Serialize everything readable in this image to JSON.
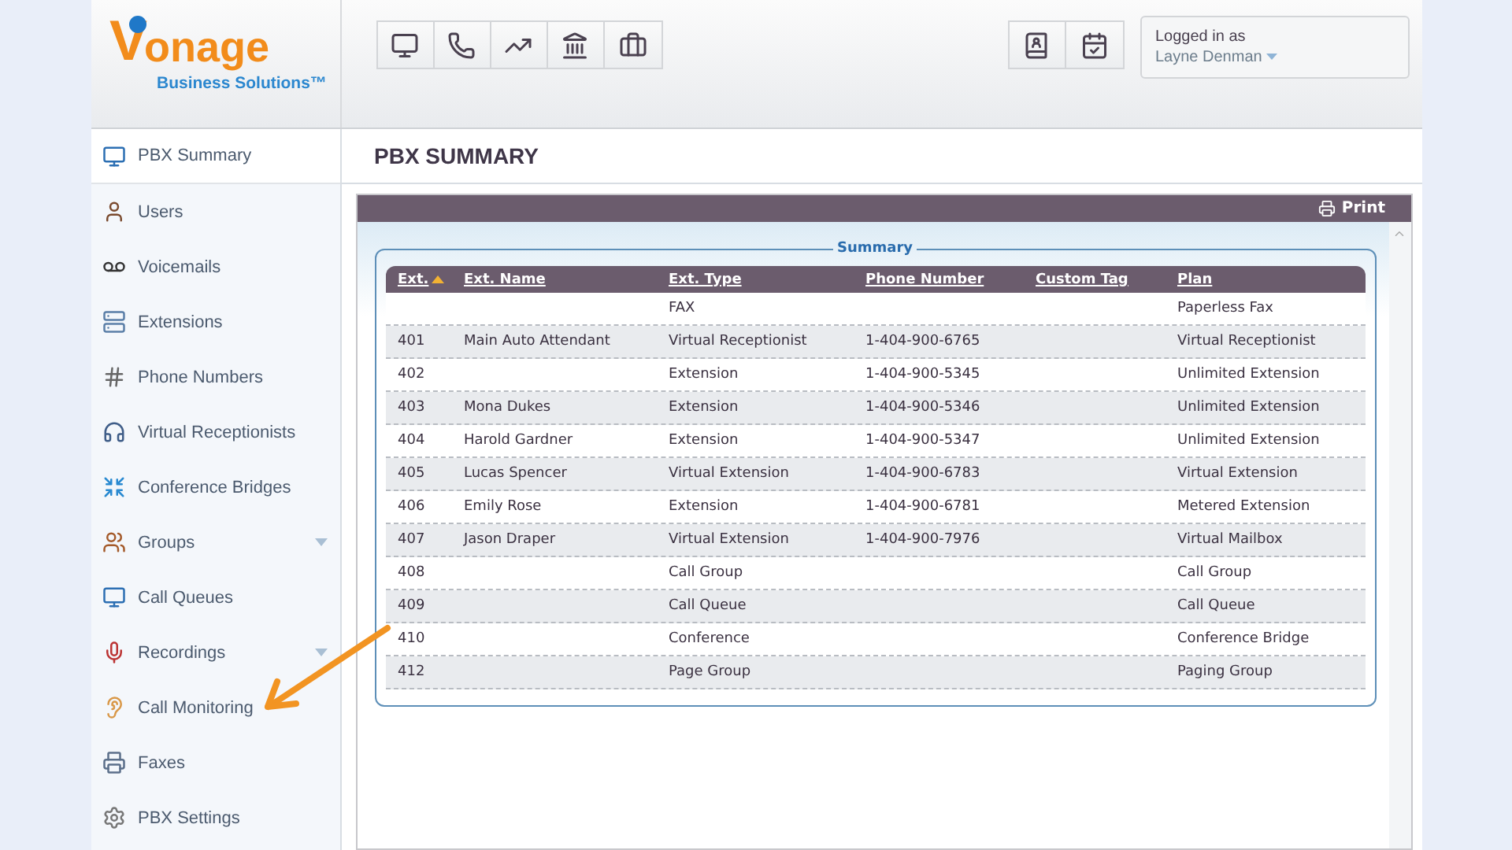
{
  "logo": {
    "initial": "V",
    "rest": "onage",
    "tagline": "Business Solutions™"
  },
  "user": {
    "caption": "Logged in as",
    "name": "Layne Denman"
  },
  "sidebar": {
    "items": [
      {
        "label": "PBX Summary",
        "selected": true,
        "expandable": false
      },
      {
        "label": "Users",
        "selected": false,
        "expandable": false
      },
      {
        "label": "Voicemails",
        "selected": false,
        "expandable": false
      },
      {
        "label": "Extensions",
        "selected": false,
        "expandable": false
      },
      {
        "label": "Phone Numbers",
        "selected": false,
        "expandable": false
      },
      {
        "label": "Virtual Receptionists",
        "selected": false,
        "expandable": false
      },
      {
        "label": "Conference Bridges",
        "selected": false,
        "expandable": false
      },
      {
        "label": "Groups",
        "selected": false,
        "expandable": true
      },
      {
        "label": "Call Queues",
        "selected": false,
        "expandable": false
      },
      {
        "label": "Recordings",
        "selected": false,
        "expandable": true
      },
      {
        "label": "Call Monitoring",
        "selected": false,
        "expandable": false
      },
      {
        "label": "Faxes",
        "selected": false,
        "expandable": false
      },
      {
        "label": "PBX Settings",
        "selected": false,
        "expandable": false
      }
    ]
  },
  "page_title": "PBX SUMMARY",
  "print_label": "Print",
  "summary": {
    "legend": "Summary",
    "columns": [
      {
        "label": "Ext.",
        "sorted": true
      },
      {
        "label": "Ext. Name",
        "sorted": false
      },
      {
        "label": "Ext. Type",
        "sorted": false
      },
      {
        "label": "Phone Number",
        "sorted": false
      },
      {
        "label": "Custom Tag",
        "sorted": false
      },
      {
        "label": "Plan",
        "sorted": false
      }
    ],
    "rows": [
      [
        "",
        "",
        "FAX",
        "",
        "",
        "Paperless Fax"
      ],
      [
        "401",
        "Main Auto Attendant",
        "Virtual Receptionist",
        "1-404-900-6765",
        "",
        "Virtual Receptionist"
      ],
      [
        "402",
        "",
        "Extension",
        "1-404-900-5345",
        "",
        "Unlimited Extension"
      ],
      [
        "403",
        "Mona Dukes",
        "Extension",
        "1-404-900-5346",
        "",
        "Unlimited Extension"
      ],
      [
        "404",
        "Harold Gardner",
        "Extension",
        "1-404-900-5347",
        "",
        "Unlimited Extension"
      ],
      [
        "405",
        "Lucas Spencer",
        "Virtual Extension",
        "1-404-900-6783",
        "",
        "Virtual Extension"
      ],
      [
        "406",
        "Emily Rose",
        "Extension",
        "1-404-900-6781",
        "",
        "Metered Extension"
      ],
      [
        "407",
        "Jason Draper",
        "Virtual Extension",
        "1-404-900-7976",
        "",
        "Virtual Mailbox"
      ],
      [
        "408",
        "",
        "Call Group",
        "",
        "",
        "Call Group"
      ],
      [
        "409",
        "",
        "Call Queue",
        "",
        "",
        "Call Queue"
      ],
      [
        "410",
        "",
        "Conference",
        "",
        "",
        "Conference Bridge"
      ],
      [
        "412",
        "",
        "Page Group",
        "",
        "",
        "Paging Group"
      ]
    ]
  }
}
